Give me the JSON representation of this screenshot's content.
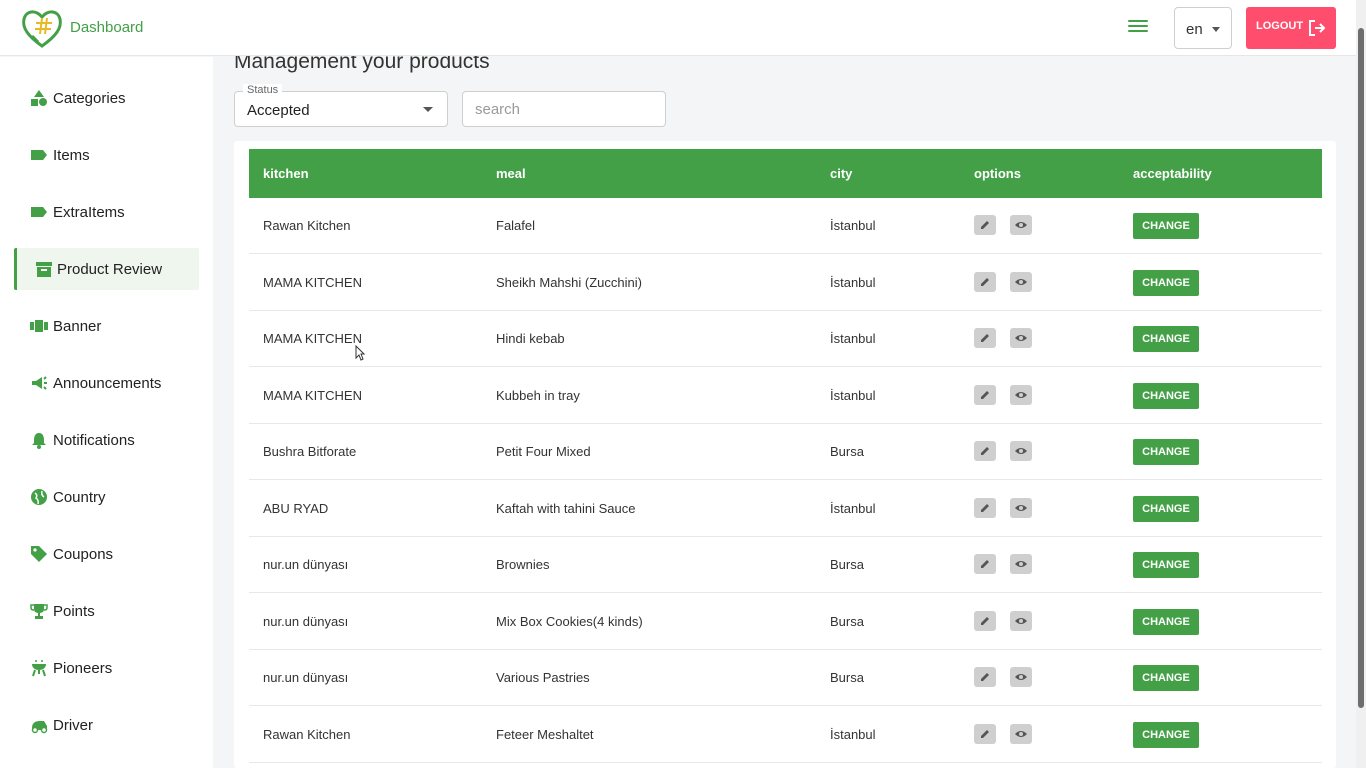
{
  "header": {
    "brand": "Dashboard",
    "language": "en",
    "logout_label": "LOGOUT"
  },
  "sidebar": {
    "items": [
      {
        "label": "Categories",
        "icon": "shapes-icon"
      },
      {
        "label": "Items",
        "icon": "label-icon"
      },
      {
        "label": "ExtraItems",
        "icon": "label-icon"
      },
      {
        "label": "Product Review",
        "icon": "archive-icon",
        "active": true
      },
      {
        "label": "Banner",
        "icon": "view-carousel-icon"
      },
      {
        "label": "Announcements",
        "icon": "campaign-icon"
      },
      {
        "label": "Notifications",
        "icon": "bell-icon"
      },
      {
        "label": "Country",
        "icon": "globe-icon"
      },
      {
        "label": "Coupons",
        "icon": "tag-icon"
      },
      {
        "label": "Points",
        "icon": "trophy-icon"
      },
      {
        "label": "Pioneers",
        "icon": "grill-icon"
      },
      {
        "label": "Driver",
        "icon": "delivery-icon"
      }
    ]
  },
  "main": {
    "title": "Management your products",
    "status_filter": {
      "label": "Status",
      "value": "Accepted"
    },
    "search_placeholder": "search",
    "table": {
      "columns": [
        "kitchen",
        "meal",
        "city",
        "options",
        "acceptability"
      ],
      "change_label": "CHANGE",
      "rows": [
        {
          "kitchen": "Rawan Kitchen",
          "meal": "Falafel",
          "city": "İstanbul"
        },
        {
          "kitchen": "MAMA KITCHEN",
          "meal": "Sheikh Mahshi (Zucchini)",
          "city": "İstanbul"
        },
        {
          "kitchen": "MAMA KITCHEN",
          "meal": "Hindi kebab",
          "city": "İstanbul"
        },
        {
          "kitchen": "MAMA KITCHEN",
          "meal": "Kubbeh in tray",
          "city": "İstanbul"
        },
        {
          "kitchen": "Bushra Bitforate",
          "meal": "Petit Four Mixed",
          "city": "Bursa"
        },
        {
          "kitchen": "ABU RYAD",
          "meal": "Kaftah with tahini Sauce",
          "city": "İstanbul"
        },
        {
          "kitchen": "nur.un dünyası",
          "meal": "Brownies",
          "city": "Bursa"
        },
        {
          "kitchen": "nur.un dünyası",
          "meal": "Mix Box Cookies(4 kinds)",
          "city": "Bursa"
        },
        {
          "kitchen": "nur.un dünyası",
          "meal": "Various Pastries",
          "city": "Bursa"
        },
        {
          "kitchen": "Rawan Kitchen",
          "meal": "Feteer Meshaltet",
          "city": "İstanbul"
        }
      ]
    }
  },
  "colors": {
    "accent": "#43a047",
    "logout": "#ff4d6d"
  }
}
